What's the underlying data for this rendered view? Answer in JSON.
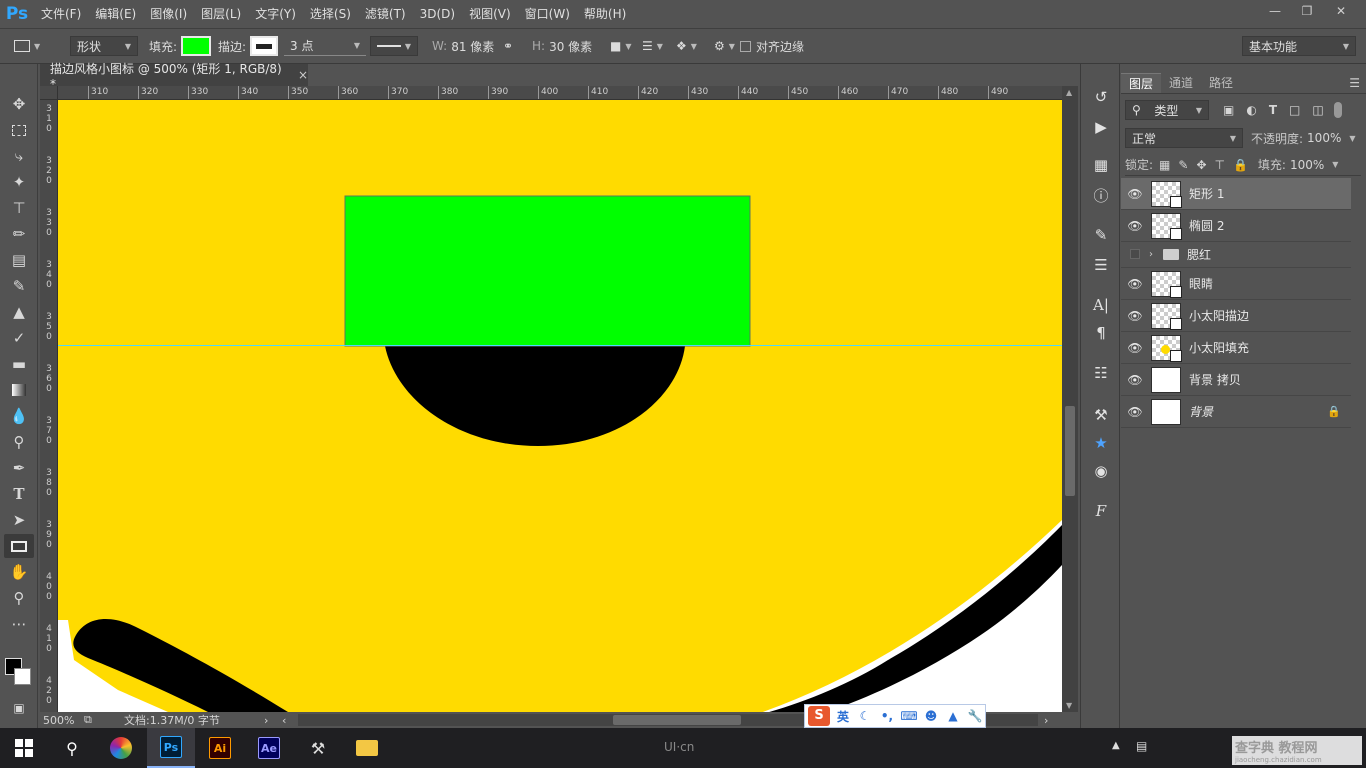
{
  "app": {
    "logo": "Ps",
    "menu": [
      "文件(F)",
      "编辑(E)",
      "图像(I)",
      "图层(L)",
      "文字(Y)",
      "选择(S)",
      "滤镜(T)",
      "3D(D)",
      "视图(V)",
      "窗口(W)",
      "帮助(H)"
    ]
  },
  "options": {
    "mode": "形状",
    "fill_label": "填充:",
    "fill_color": "#00ff00",
    "stroke_label": "描边:",
    "stroke_width": "3 点",
    "w_label": "W:",
    "w_value": "81 像素",
    "h_label": "H:",
    "h_value": "30 像素",
    "align_edges": "对齐边缘",
    "workspace": "基本功能"
  },
  "document": {
    "tab_title": "描边风格小图标 @ 500% (矩形 1, RGB/8) *",
    "close": "×",
    "zoom": "500%",
    "doc_info": "文档:1.37M/0 字节"
  },
  "rulers": {
    "top": [
      "310",
      "320",
      "330",
      "340",
      "350",
      "360",
      "370",
      "380",
      "390",
      "400",
      "410",
      "420",
      "430",
      "440",
      "450",
      "460",
      "470",
      "480",
      "490"
    ],
    "left": [
      [
        "3",
        "1",
        "0"
      ],
      [
        "3",
        "2",
        "0"
      ],
      [
        "3",
        "3",
        "0"
      ],
      [
        "3",
        "4",
        "0"
      ],
      [
        "3",
        "5",
        "0"
      ],
      [
        "3",
        "6",
        "0"
      ],
      [
        "3",
        "7",
        "0"
      ],
      [
        "3",
        "8",
        "0"
      ],
      [
        "3",
        "9",
        "0"
      ],
      [
        "4",
        "0",
        "0"
      ],
      [
        "4",
        "1",
        "0"
      ],
      [
        "4",
        "2",
        "0"
      ]
    ]
  },
  "layers_panel": {
    "tabs": [
      "图层",
      "通道",
      "路径"
    ],
    "filter": "类型",
    "blend_mode": "正常",
    "opacity_label": "不透明度:",
    "opacity": "100%",
    "lock_label": "锁定:",
    "fill_label": "填充:",
    "fill": "100%",
    "layers": [
      {
        "name": "矩形 1",
        "visible": true,
        "selected": true
      },
      {
        "name": "椭圆 2",
        "visible": true,
        "selected": false
      },
      {
        "name": "腮红",
        "visible": false,
        "selected": false
      },
      {
        "name": "眼睛",
        "visible": true,
        "selected": false
      },
      {
        "name": "小太阳描边",
        "visible": true,
        "selected": false
      },
      {
        "name": "小太阳填充",
        "visible": true,
        "selected": false
      },
      {
        "name": "背景 拷贝",
        "visible": true,
        "selected": false
      },
      {
        "name": "背景",
        "visible": true,
        "selected": false
      }
    ]
  },
  "taskbar": {
    "apps": [
      "Ps",
      "Ai",
      "Ae"
    ],
    "watermark": "UI·cn",
    "ime_lang": "英",
    "site_mark": "查字典 教程网",
    "site_url": "jiaocheng.chazidian.com"
  },
  "colors": {
    "canvas_yellow": "#ffdb00",
    "shape_green": "#00ff00",
    "guide": "#4fd6ff"
  }
}
